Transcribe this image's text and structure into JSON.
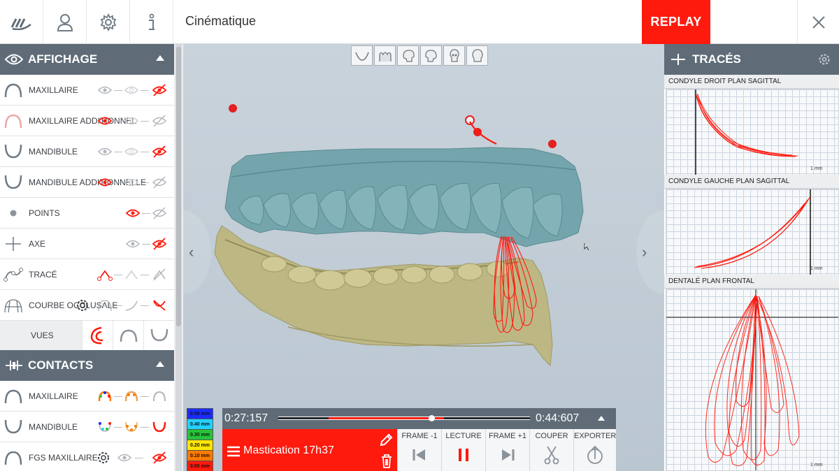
{
  "topbar": {
    "title": "Cinématique",
    "replay_label": "REPLAY"
  },
  "affichage": {
    "title": "AFFICHAGE",
    "rows": [
      {
        "label": "MAXILLAIRE"
      },
      {
        "label": "MAXILLAIRE ADDITIONNEL"
      },
      {
        "label": "MANDIBULE"
      },
      {
        "label": "MANDIBULE ADDITIONNELLE"
      },
      {
        "label": "POINTS"
      },
      {
        "label": "AXE"
      },
      {
        "label": "TRACÉ"
      },
      {
        "label": "COURBE OCCLUSALE"
      }
    ],
    "vues_label": "VUES"
  },
  "contacts": {
    "title": "CONTACTS",
    "rows": [
      {
        "label": "MAXILLAIRE"
      },
      {
        "label": "MANDIBULE"
      },
      {
        "label": "FGS MAXILLAIRE"
      }
    ]
  },
  "legend": [
    "0.50 mm",
    "0.40 mm",
    "0.30 mm",
    "0.20 mm",
    "0.10 mm",
    "0.00 mm"
  ],
  "legend_colors": [
    "#1a2cff",
    "#22d3ff",
    "#27c43a",
    "#ffe600",
    "#ff7a00",
    "#ff1a0e"
  ],
  "player": {
    "time_current": "0:27:157",
    "time_end": "0:44:607",
    "recording_name": "Mastication 17h37",
    "buttons": [
      "FRAME -1",
      "LECTURE",
      "FRAME +1",
      "COUPER",
      "EXPORTER"
    ]
  },
  "traces": {
    "title": "TRACÉS",
    "plots": [
      {
        "title": "CONDYLE DROIT PLAN SAGITTAL",
        "scale": "1 mm"
      },
      {
        "title": "CONDYLE GAUCHE PLAN SAGITTAL",
        "scale": "1 mm"
      },
      {
        "title": "DENTALÉ PLAN FRONTAL",
        "scale": "1 mm"
      }
    ]
  },
  "colors": {
    "accent": "#ff1a0e",
    "header": "#5f6c78",
    "maxilla": "#6fa5ae",
    "mandible": "#b8b283"
  }
}
